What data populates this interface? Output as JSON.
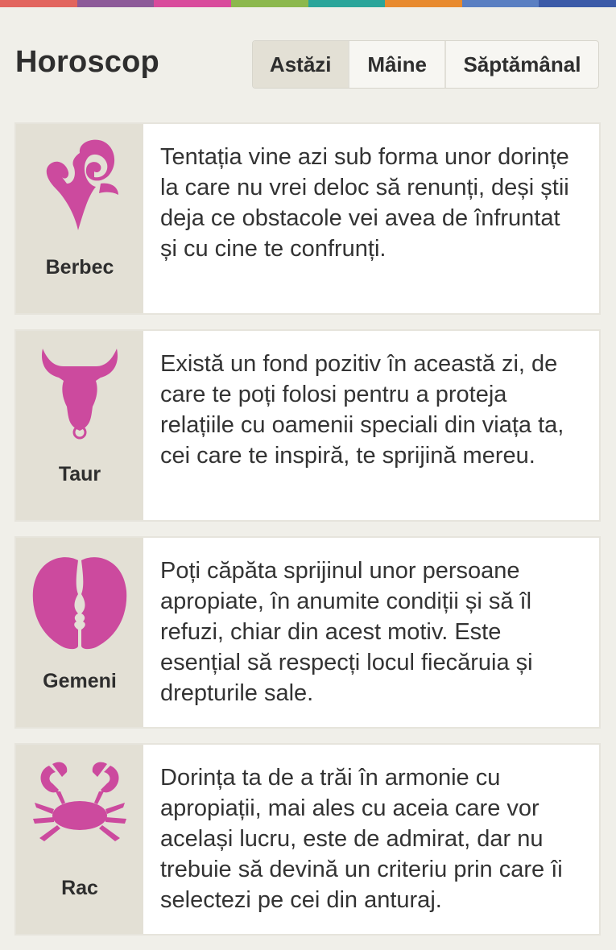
{
  "colors": {
    "topbar": [
      "#e2655e",
      "#8d5a99",
      "#d94b9c",
      "#8cb84d",
      "#2aa59a",
      "#e88a2e",
      "#5a7fc2",
      "#3b5aa8"
    ],
    "accent": "#cc4a9e",
    "panel": "#e3e0d5",
    "background": "#f0efe9"
  },
  "header": {
    "title": "Horoscop",
    "tabs": [
      {
        "label": "Astăzi",
        "active": true
      },
      {
        "label": "Mâine",
        "active": false
      },
      {
        "label": "Săptămânal",
        "active": false
      }
    ]
  },
  "signs": [
    {
      "name": "Berbec",
      "icon": "aries-icon",
      "text": "Tentația vine azi sub forma unor dorințe la care nu vrei deloc să renunți, deși știi deja ce obstacole vei avea de înfruntat și cu cine te confrunți."
    },
    {
      "name": "Taur",
      "icon": "taurus-icon",
      "text": "Există un fond pozitiv în această zi, de care te poți folosi pentru a proteja relațiile cu oamenii speciali din viața ta, cei care te inspiră, te sprijină mereu."
    },
    {
      "name": "Gemeni",
      "icon": "gemini-icon",
      "text": "Poți căpăta sprijinul unor persoane apropiate, în anumite condiții și să îl refuzi, chiar din acest motiv. Este esențial să respecți locul fiecăruia și drepturile sale."
    },
    {
      "name": "Rac",
      "icon": "cancer-icon",
      "text": "Dorința ta de a trăi în armonie cu apropiații, mai ales cu aceia care vor același lucru, este de admirat, dar nu trebuie să devină un criteriu prin care îi selectezi pe cei din anturaj."
    }
  ]
}
